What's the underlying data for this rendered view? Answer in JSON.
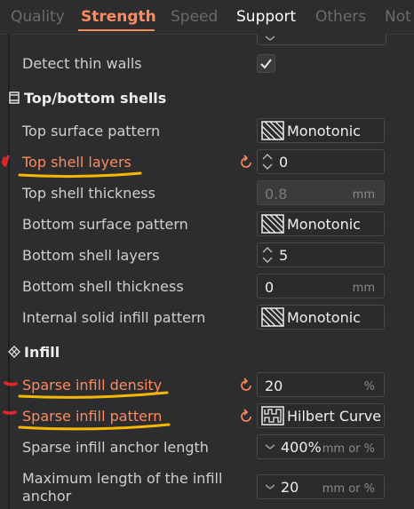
{
  "tabs": {
    "quality": "Quality",
    "strength": "Strength",
    "speed": "Speed",
    "support": "Support",
    "others": "Others",
    "notes": "Not"
  },
  "walls": {
    "detect_thin_walls": {
      "label": "Detect thin walls",
      "checked": true
    }
  },
  "top_bottom": {
    "section_title": "Top/bottom shells",
    "top_surface_pattern": {
      "label": "Top surface pattern",
      "value": "Monotonic"
    },
    "top_shell_layers": {
      "label": "Top shell layers",
      "value": "0"
    },
    "top_shell_thickness": {
      "label": "Top shell thickness",
      "value": "0.8",
      "unit": "mm"
    },
    "bottom_surface_pattern": {
      "label": "Bottom surface pattern",
      "value": "Monotonic"
    },
    "bottom_shell_layers": {
      "label": "Bottom shell layers",
      "value": "5"
    },
    "bottom_shell_thickness": {
      "label": "Bottom shell thickness",
      "value": "0",
      "unit": "mm"
    },
    "internal_solid_infill_pattern": {
      "label": "Internal solid infill pattern",
      "value": "Monotonic"
    }
  },
  "infill": {
    "section_title": "Infill",
    "sparse_infill_density": {
      "label": "Sparse infill density",
      "value": "20",
      "unit": "%"
    },
    "sparse_infill_pattern": {
      "label": "Sparse infill pattern",
      "value": "Hilbert Curve"
    },
    "sparse_infill_anchor_length": {
      "label": "Sparse infill anchor length",
      "value": "400%",
      "unit": "mm or %"
    },
    "max_infill_anchor_length": {
      "label": "Maximum length of the infill anchor",
      "value": "20",
      "unit": "mm or %"
    }
  },
  "colors": {
    "accent": "#ff8a5c",
    "background": "#2d2d30",
    "annotation_underline": "#f5b800",
    "annotation_mark": "#e8262a"
  }
}
